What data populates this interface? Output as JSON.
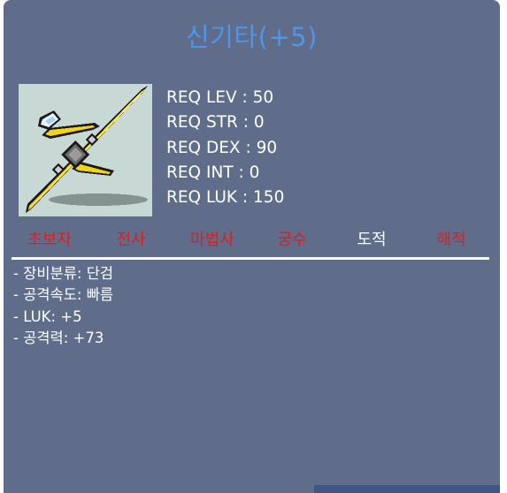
{
  "item": {
    "name": "신기타(+5)",
    "icon": "ilbi-claw-dagger-icon",
    "title_color": "#4f95e8",
    "panel_color": "#5f6c8a"
  },
  "requirements": [
    "REQ LEV : 50",
    "REQ STR : 0",
    "REQ DEX : 90",
    "REQ INT : 0",
    "REQ LUK : 150"
  ],
  "jobs": [
    {
      "label": "초보자",
      "allowed": false
    },
    {
      "label": "전사",
      "allowed": false
    },
    {
      "label": "마법사",
      "allowed": false
    },
    {
      "label": "궁수",
      "allowed": false
    },
    {
      "label": "도적",
      "allowed": true
    },
    {
      "label": "해적",
      "allowed": false
    }
  ],
  "job_colors": {
    "allowed": "#ffffff",
    "not_allowed": "#e41b1b"
  },
  "stats": [
    "- 장비분류: 단검",
    "- 공격속도: 빠름",
    "- LUK: +5",
    "- 공격력: +73"
  ]
}
